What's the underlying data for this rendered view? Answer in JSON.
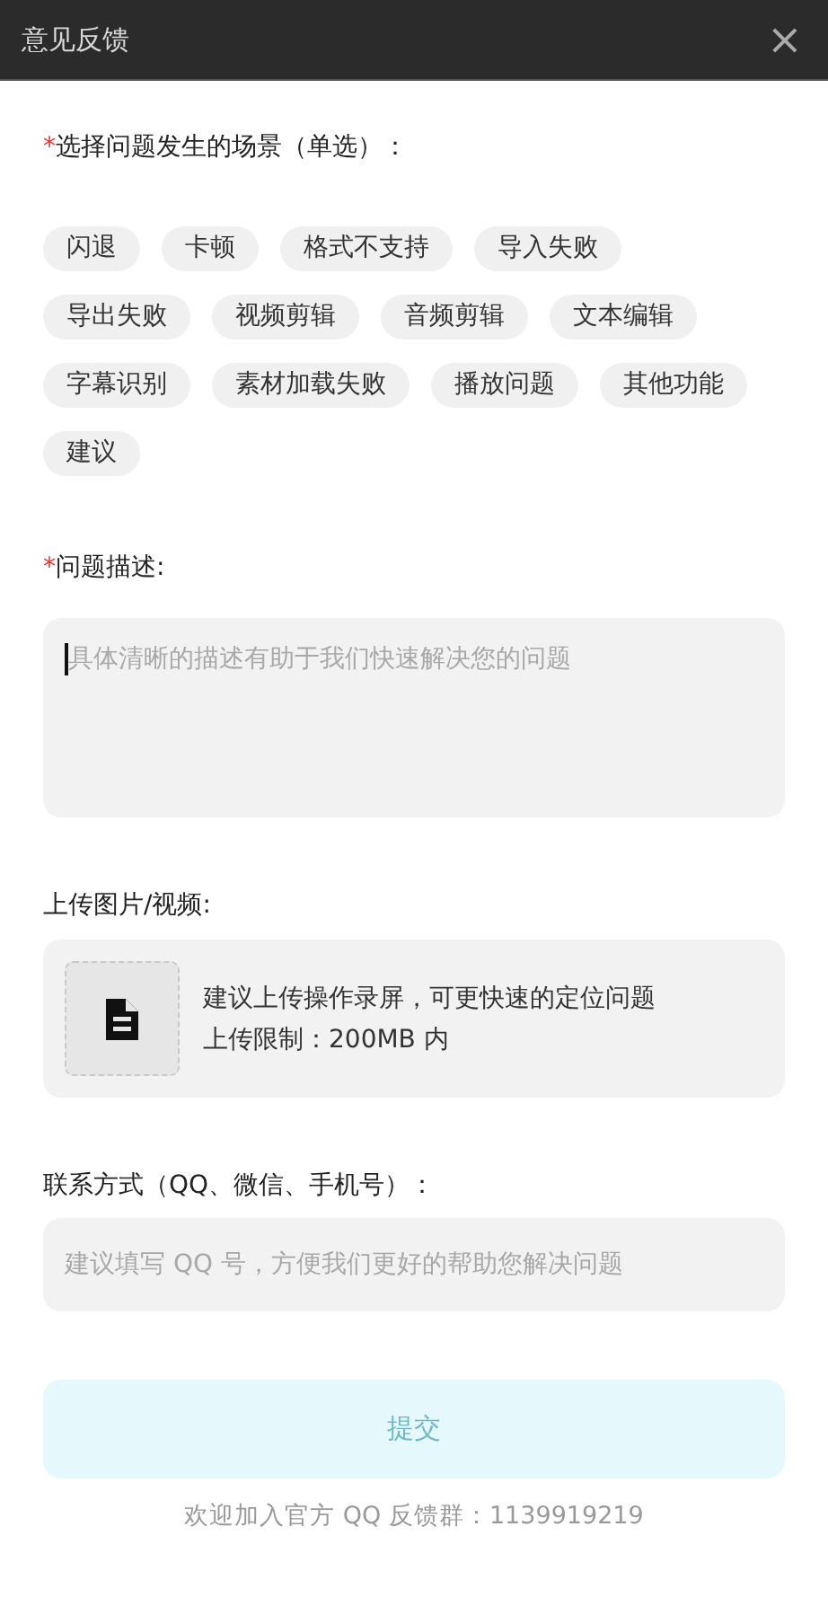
{
  "window": {
    "title": "意见反馈",
    "close": "×"
  },
  "scene": {
    "required_mark": "*",
    "label": "选择问题发生的场景（单选）：",
    "options": [
      {
        "label": "闪退",
        "selected": false
      },
      {
        "label": "卡顿",
        "selected": false
      },
      {
        "label": "格式不支持",
        "selected": false
      },
      {
        "label": "导入失败",
        "selected": false
      },
      {
        "label": "导出失败",
        "selected": false
      },
      {
        "label": "视频剪辑",
        "selected": false
      },
      {
        "label": "音频剪辑",
        "selected": false
      },
      {
        "label": "文本编辑",
        "selected": false
      },
      {
        "label": "字幕识别",
        "selected": false
      },
      {
        "label": "素材加载失败",
        "selected": false
      },
      {
        "label": "播放问题",
        "selected": false
      },
      {
        "label": "其他功能",
        "selected": false
      },
      {
        "label": "建议",
        "selected": false
      }
    ]
  },
  "description": {
    "required_mark": "*",
    "label": "问题描述:",
    "placeholder": "具体清晰的描述有助于我们快速解决您的问题",
    "focused": true
  },
  "upload": {
    "label": "上传图片/视频:",
    "hint": "建议上传操作录屏，可更快速的定位问题",
    "limit": "上传限制：200MB 内"
  },
  "contact": {
    "label": "联系方式（QQ、微信、手机号）：",
    "placeholder": "建议填写 QQ 号，方便我们更好的帮助您解决问题"
  },
  "submit": {
    "label": "提交",
    "disabled": true
  },
  "footer": "欢迎加入官方 QQ 反馈群：1139919219"
}
